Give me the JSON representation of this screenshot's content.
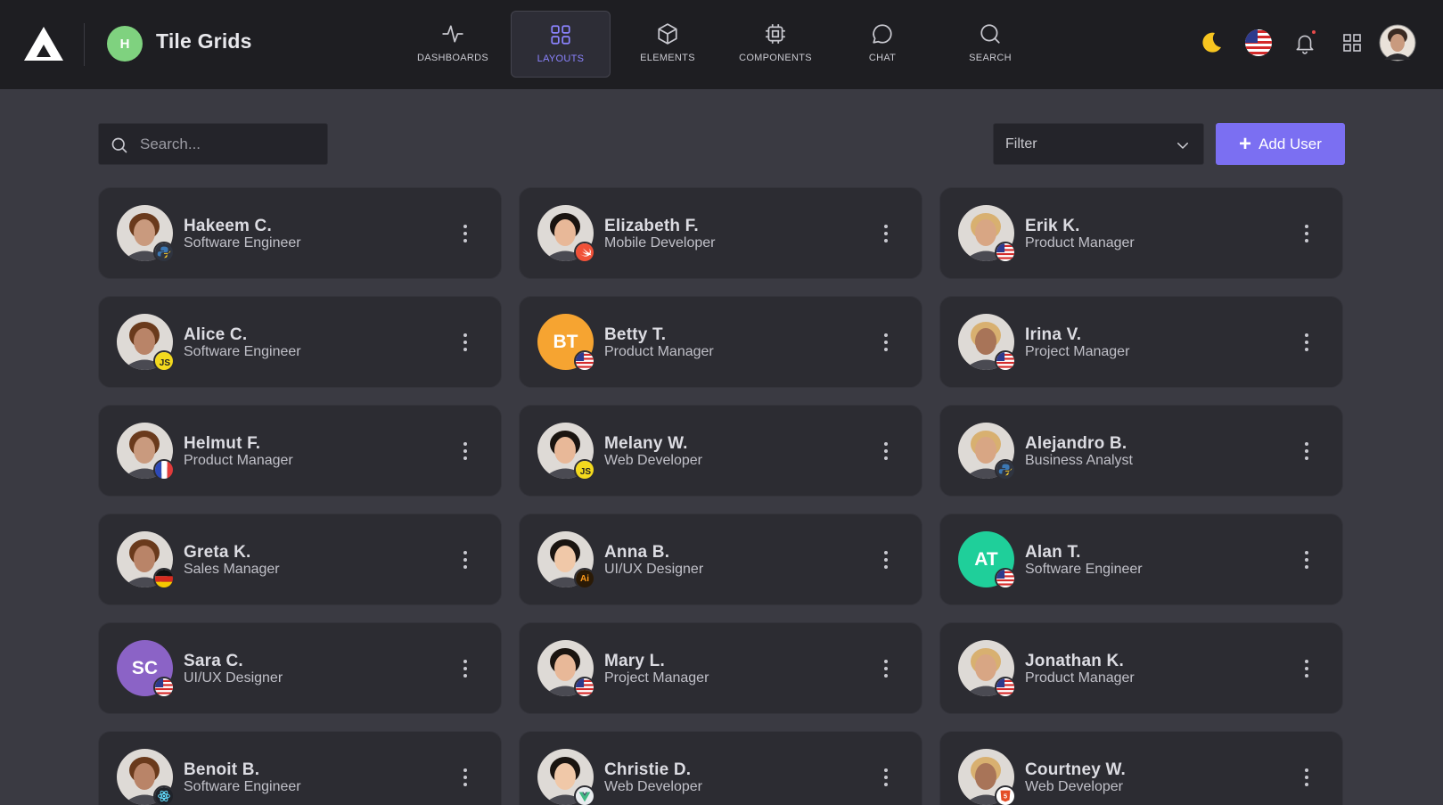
{
  "header": {
    "project_initial": "H",
    "project_title": "Tile Grids",
    "nav": [
      {
        "label": "DASHBOARDS",
        "icon": "activity-icon",
        "active": false
      },
      {
        "label": "LAYOUTS",
        "icon": "grid-icon",
        "active": true
      },
      {
        "label": "ELEMENTS",
        "icon": "cube-icon",
        "active": false
      },
      {
        "label": "COMPONENTS",
        "icon": "chip-icon",
        "active": false
      },
      {
        "label": "CHAT",
        "icon": "chat-bubble-icon",
        "active": false
      },
      {
        "label": "SEARCH",
        "icon": "search-icon",
        "active": false
      }
    ],
    "right_icons": [
      "moon-icon",
      "us-flag-icon",
      "bell-icon",
      "apps-grid-icon",
      "user-avatar"
    ]
  },
  "toolbar": {
    "search_placeholder": "Search...",
    "filter_label": "Filter",
    "add_user_label": "Add User"
  },
  "colors": {
    "accent": "#7b6ff2",
    "topbar_bg": "#1e1e22",
    "page_bg": "#3a3a42",
    "card_bg": "#2c2c32"
  },
  "users": [
    {
      "name": "Hakeem C.",
      "role": "Software Engineer",
      "avatar_type": "photo",
      "badge": "python-icon"
    },
    {
      "name": "Elizabeth F.",
      "role": "Mobile Developer",
      "avatar_type": "photo",
      "badge": "swift-icon"
    },
    {
      "name": "Erik K.",
      "role": "Product Manager",
      "avatar_type": "photo",
      "badge": "us-flag-icon"
    },
    {
      "name": "Alice C.",
      "role": "Software Engineer",
      "avatar_type": "photo",
      "badge": "js-icon"
    },
    {
      "name": "Betty T.",
      "role": "Product Manager",
      "avatar_type": "initials",
      "initials": "BT",
      "color": "#f6a431",
      "badge": "us-flag-icon"
    },
    {
      "name": "Irina V.",
      "role": "Project Manager",
      "avatar_type": "photo",
      "badge": "us-flag-icon"
    },
    {
      "name": "Helmut F.",
      "role": "Product Manager",
      "avatar_type": "photo",
      "badge": "france-flag-icon"
    },
    {
      "name": "Melany W.",
      "role": "Web Developer",
      "avatar_type": "photo",
      "badge": "js-icon"
    },
    {
      "name": "Alejandro B.",
      "role": "Business Analyst",
      "avatar_type": "photo",
      "badge": "python-icon"
    },
    {
      "name": "Greta K.",
      "role": "Sales Manager",
      "avatar_type": "photo",
      "badge": "germany-flag-icon"
    },
    {
      "name": "Anna B.",
      "role": "UI/UX Designer",
      "avatar_type": "photo",
      "badge": "illustrator-icon"
    },
    {
      "name": "Alan T.",
      "role": "Software Engineer",
      "avatar_type": "initials",
      "initials": "AT",
      "color": "#1fcf9a",
      "badge": "us-flag-icon"
    },
    {
      "name": "Sara C.",
      "role": "UI/UX Designer",
      "avatar_type": "initials",
      "initials": "SC",
      "color": "#8b63c6",
      "badge": "us-flag-icon"
    },
    {
      "name": "Mary L.",
      "role": "Project Manager",
      "avatar_type": "photo",
      "badge": "us-flag-icon"
    },
    {
      "name": "Jonathan K.",
      "role": "Product Manager",
      "avatar_type": "photo",
      "badge": "us-flag-icon"
    },
    {
      "name": "Benoit B.",
      "role": "Software Engineer",
      "avatar_type": "photo",
      "badge": "react-icon"
    },
    {
      "name": "Christie D.",
      "role": "Web Developer",
      "avatar_type": "photo",
      "badge": "vue-icon"
    },
    {
      "name": "Courtney W.",
      "role": "Web Developer",
      "avatar_type": "photo",
      "badge": "html5-icon"
    }
  ]
}
